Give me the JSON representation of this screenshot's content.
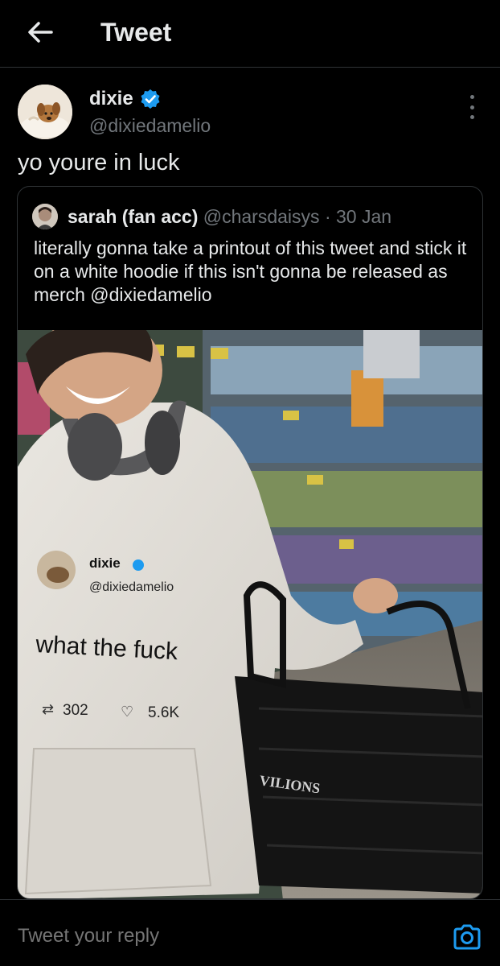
{
  "header": {
    "title": "Tweet",
    "back_icon": "arrow-left-icon"
  },
  "tweet": {
    "author": {
      "name": "dixie",
      "handle": "@dixiedamelio",
      "verified": true
    },
    "text": "yo youre in luck",
    "more_icon": "more-vertical-icon"
  },
  "quote": {
    "author": {
      "name": "sarah (fan acc)",
      "handle": "@charsdaisys",
      "separator": "·",
      "date": "30 Jan"
    },
    "text": "literally gonna take a printout of this tweet and stick it on a white hoodie if this isn't gonna be released as merch",
    "mention": "@dixiedamelio",
    "photo": {
      "hoodie_print": {
        "name": "dixie",
        "handle": "@dixiedamelio",
        "text": "what the fuck",
        "retweets": "302",
        "likes": "5.6K"
      },
      "basket_text": "VILIONS"
    }
  },
  "reply": {
    "placeholder": "Tweet your reply",
    "camera_icon": "camera-icon"
  },
  "colors": {
    "background": "#000000",
    "text": "#e7e9ea",
    "secondary": "#71767b",
    "border": "#2f3336",
    "accent": "#1d9bf0"
  }
}
